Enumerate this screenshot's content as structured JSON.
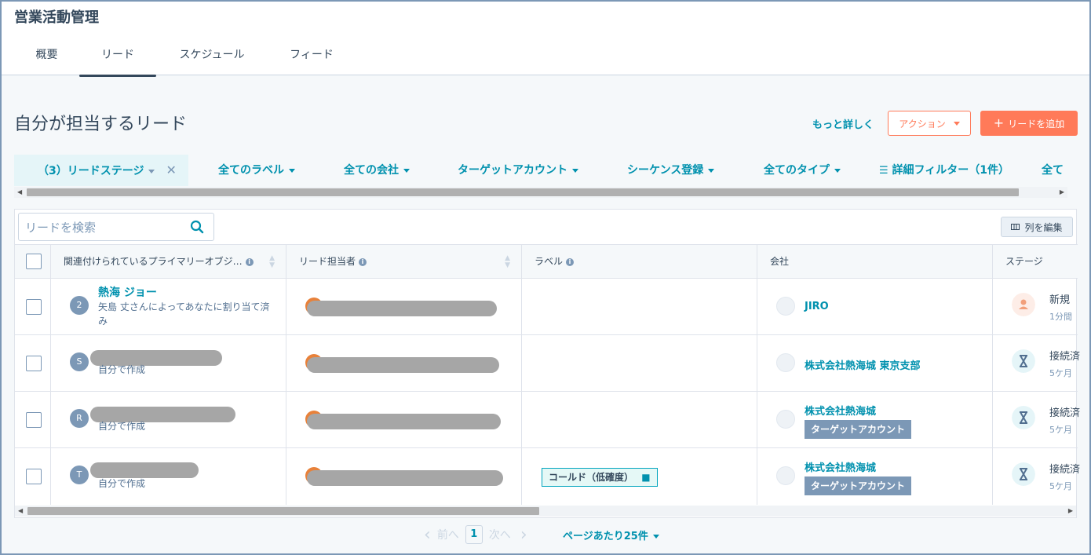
{
  "app": {
    "title": "営業活動管理"
  },
  "tabs": [
    {
      "label": "概要",
      "active": false
    },
    {
      "label": "リード",
      "active": true
    },
    {
      "label": "スケジュール",
      "active": false
    },
    {
      "label": "フィード",
      "active": false
    }
  ],
  "page": {
    "title": "自分が担当するリード",
    "more_link": "もっと詳しく",
    "action_button": "アクション",
    "add_button": "リードを追加"
  },
  "filters": [
    {
      "label": "（3）リードステージ",
      "active": true
    },
    {
      "label": "全てのラベル"
    },
    {
      "label": "全ての会社"
    },
    {
      "label": "ターゲットアカウント"
    },
    {
      "label": "シーケンス登録"
    },
    {
      "label": "全てのタイプ"
    },
    {
      "label": "詳細フィルター（1件）"
    },
    {
      "label": "全て"
    }
  ],
  "table": {
    "search_placeholder": "リードを検索",
    "edit_columns": "列を編集",
    "columns": [
      "関連付けられているプライマリーオブジ…",
      "リード担当者",
      "ラベル",
      "会社",
      "ステージ"
    ],
    "rows": [
      {
        "avatar": "2",
        "name": "熱海 ジョー",
        "sub": "矢島 丈さんによってあなたに割り当て済み",
        "label": "",
        "company": "JIRO",
        "target": "",
        "stage": "新規",
        "stage_time": "1分間",
        "stage_type": "new"
      },
      {
        "avatar": "S",
        "name": "",
        "sub": "自分で作成",
        "label": "",
        "company": "株式会社熱海城 東京支部",
        "target": "",
        "stage": "接続済",
        "stage_time": "5ケ月",
        "stage_type": "wait"
      },
      {
        "avatar": "R",
        "name": "",
        "sub": "自分で作成",
        "label": "",
        "company": "株式会社熱海城",
        "target": "ターゲットアカウント",
        "stage": "接続済",
        "stage_time": "5ケ月",
        "stage_type": "wait"
      },
      {
        "avatar": "T",
        "name": "",
        "sub": "自分で作成",
        "label": "コールド（低確度）",
        "company": "株式会社熱海城",
        "target": "ターゲットアカウント",
        "stage": "接続済",
        "stage_time": "5ケ月",
        "stage_type": "wait"
      }
    ]
  },
  "pagination": {
    "prev": "前へ",
    "page": "1",
    "next": "次へ",
    "per_page": "ページあたり25件"
  },
  "colors": {
    "accent": "#0091ae",
    "primary_button": "#ff7a59",
    "text": "#33475b",
    "tag_target": "#7c98b6"
  }
}
